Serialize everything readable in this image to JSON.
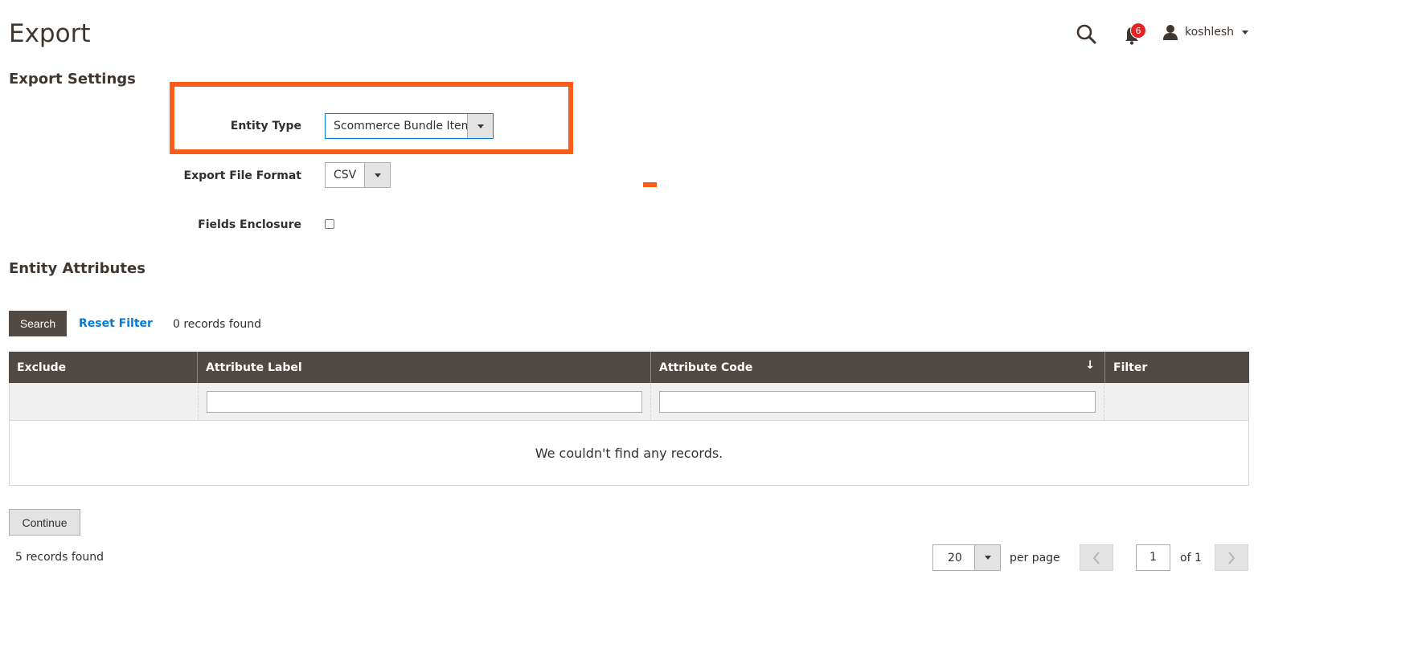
{
  "page": {
    "title": "Export"
  },
  "header": {
    "notifications_count": "6",
    "user_name": "koshlesh"
  },
  "export_settings": {
    "title": "Export Settings",
    "entity_type": {
      "label": "Entity Type",
      "value": "Scommerce Bundle Items"
    },
    "file_format": {
      "label": "Export File Format",
      "value": "CSV"
    },
    "fields_enclosure": {
      "label": "Fields Enclosure",
      "checked": false
    }
  },
  "entity_attributes": {
    "title": "Entity Attributes",
    "search_label": "Search",
    "reset_filter_label": "Reset Filter",
    "records_found": "0 records found",
    "columns": [
      "Exclude",
      "Attribute Label",
      "Attribute Code",
      "Filter"
    ],
    "empty_message": "We couldn't find any records."
  },
  "footer": {
    "continue_label": "Continue",
    "records_found": "5 records found",
    "per_page_value": "20",
    "per_page_label": "per page",
    "current_page": "1",
    "of_pages": "of 1"
  },
  "colors": {
    "header_bg": "#514943",
    "highlight": "#fd5b1a",
    "link": "#007bdb",
    "badge": "#e22626"
  }
}
